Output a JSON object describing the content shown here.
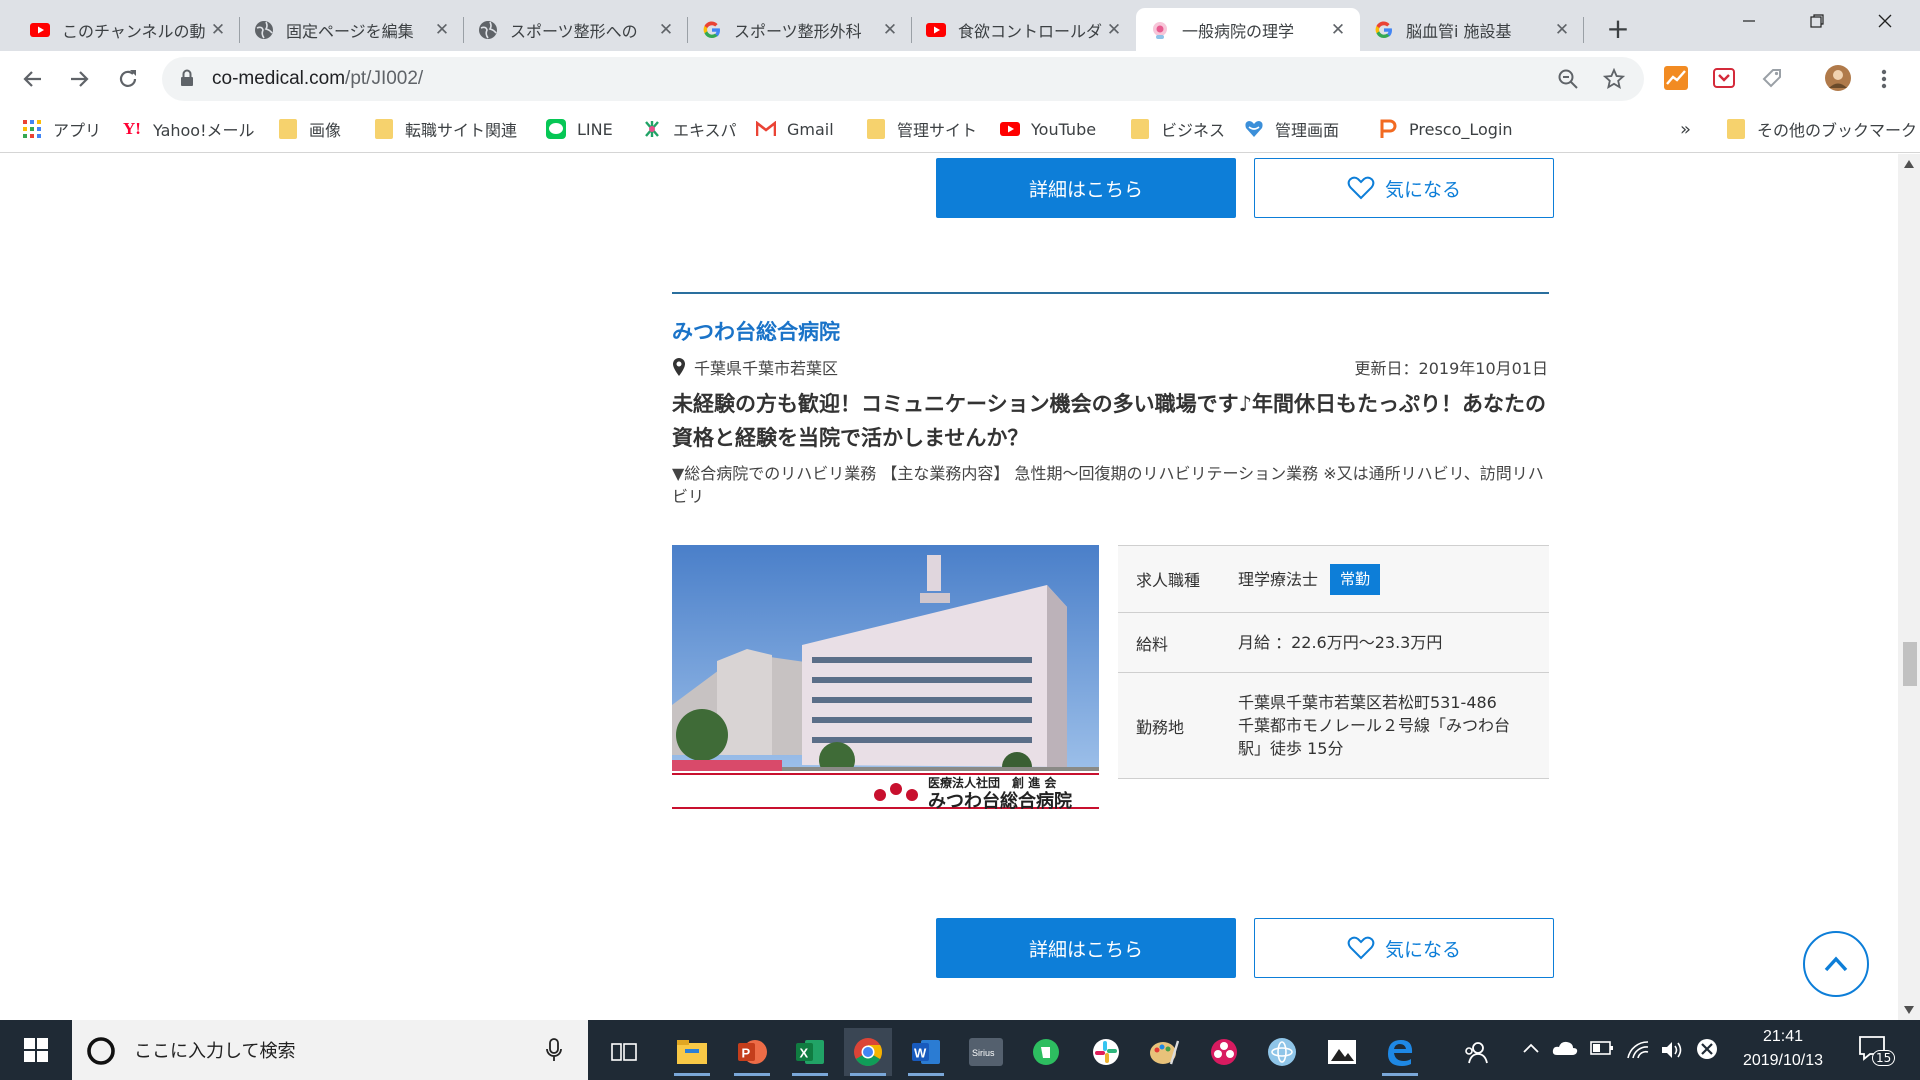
{
  "tabs": [
    {
      "title": "このチャンネルの動",
      "icon": "youtube-icon",
      "active": false
    },
    {
      "title": "固定ページを編集",
      "icon": "globe-icon",
      "active": false
    },
    {
      "title": "スポーツ整形への",
      "icon": "globe-icon",
      "active": false
    },
    {
      "title": "スポーツ整形外科",
      "icon": "google-icon",
      "active": false
    },
    {
      "title": "食欲コントロールダ",
      "icon": "youtube-icon",
      "active": false
    },
    {
      "title": "一般病院の理学",
      "icon": "site-icon",
      "active": true
    },
    {
      "title": "脳血管i 施設基",
      "icon": "google-icon",
      "active": false
    }
  ],
  "tab_close": "✕",
  "address": {
    "domain": "co-medical.com",
    "path": "/pt/JI002/"
  },
  "bookmarks": [
    {
      "label": "アプリ",
      "icon": "apps-grid-icon"
    },
    {
      "label": "Yahoo!メール",
      "icon": "yahoo-icon"
    },
    {
      "label": "画像",
      "icon": "folder-icon"
    },
    {
      "label": "転職サイト関連",
      "icon": "folder-icon"
    },
    {
      "label": "LINE",
      "icon": "line-icon"
    },
    {
      "label": "エキスパ",
      "icon": "ekispa-icon"
    },
    {
      "label": "Gmail",
      "icon": "gmail-icon"
    },
    {
      "label": "管理サイト",
      "icon": "folder-icon"
    },
    {
      "label": "YouTube",
      "icon": "youtube-icon"
    },
    {
      "label": "ビジネス",
      "icon": "folder-icon"
    },
    {
      "label": "管理画面",
      "icon": "heart-shield-icon"
    },
    {
      "label": "Presco_Login",
      "icon": "presco-icon"
    }
  ],
  "bookmarks_more": "»",
  "other_bookmarks": "その他のブックマーク",
  "page": {
    "detail_button": "詳細はこちら",
    "fav_button": "気になる",
    "hospital_name": "みつわ台総合病院",
    "location": "千葉県千葉市若葉区",
    "updated": "更新日：2019年10月01日",
    "catch": "未経験の方も歓迎！コミュニケーション機会の多い職場です♪年間休日もたっぷり！あなたの資格と経験を当院で活かしませんか？",
    "description": "▼総合病院でのリハビリ業務 【主な業務内容】 急性期～回復期のリハビリテーション業務 ※又は通所リハビリ、訪問リハビリ",
    "photo_logo_sub": "医療法人社団　創 進 会",
    "photo_logo_main": "みつわ台総合病院",
    "info": {
      "job_label": "求人職種",
      "job_value": "理学療法士",
      "job_badge": "常勤",
      "salary_label": "給料",
      "salary_value": "月給 ：22.6万円～23.3万円",
      "place_label": "勤務地",
      "place_line1": "千葉県千葉市若葉区若松町531-486",
      "place_line2": "千葉都市モノレール２号線「みつわ台駅」徒歩 15分"
    }
  },
  "taskbar": {
    "search_placeholder": "ここに入力して検索",
    "time": "21:41",
    "date": "2019/10/13",
    "notification_count": "15"
  },
  "colors": {
    "accent": "#0d7ed8",
    "link": "#1a73c8",
    "rule": "#2a6f9e"
  }
}
